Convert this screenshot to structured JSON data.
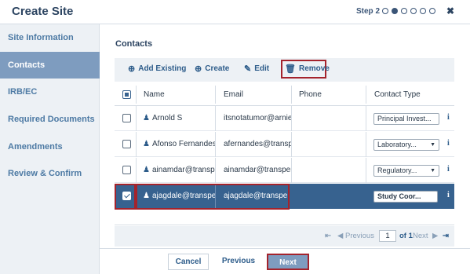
{
  "header": {
    "title": "Create Site",
    "step_label": "Step 2",
    "steps_total": 6,
    "steps_current": 1,
    "close_glyph": "✖"
  },
  "sidebar": {
    "items": [
      {
        "label": "Site Information",
        "active": false
      },
      {
        "label": "Contacts",
        "active": true
      },
      {
        "label": "IRB/EC",
        "active": false
      },
      {
        "label": "Required Documents",
        "active": false
      },
      {
        "label": "Amendments",
        "active": false
      },
      {
        "label": "Review & Confirm",
        "active": false
      }
    ]
  },
  "main": {
    "section_title": "Contacts",
    "toolbar": {
      "add_existing": "Add Existing",
      "create": "Create",
      "edit": "Edit",
      "remove": "Remove"
    },
    "table": {
      "columns": [
        "Name",
        "Email",
        "Phone",
        "Contact Type"
      ],
      "rows": [
        {
          "name": "Arnold S",
          "email": "itsnotatumor@arnie.com",
          "phone": "",
          "contact_type": "Principal Invest...",
          "checked": false,
          "selected": false,
          "has_dropdown": false
        },
        {
          "name": "Afonso Fernandes",
          "email": "afernandes@transperfect.com",
          "phone": "",
          "contact_type": "Laboratory...",
          "checked": false,
          "selected": false,
          "has_dropdown": true
        },
        {
          "name": "ainamdar@transperfect.com",
          "email": "ainamdar@transperfect.com",
          "phone": "",
          "contact_type": "Regulatory...",
          "checked": false,
          "selected": false,
          "has_dropdown": true
        },
        {
          "name": "ajagdale@transperfect.com",
          "email": "ajagdale@transperfect.com",
          "phone": "",
          "contact_type": "Study Coor...",
          "checked": true,
          "selected": true,
          "has_dropdown": false
        }
      ]
    },
    "pager": {
      "previous": "Previous",
      "page": "1",
      "of": "of 1",
      "next": "Next"
    }
  },
  "footer": {
    "cancel": "Cancel",
    "previous": "Previous",
    "next": "Next"
  },
  "colors": {
    "accent": "#37628f",
    "active_nav": "#7e9cbf",
    "highlight_border": "#a4232c"
  }
}
